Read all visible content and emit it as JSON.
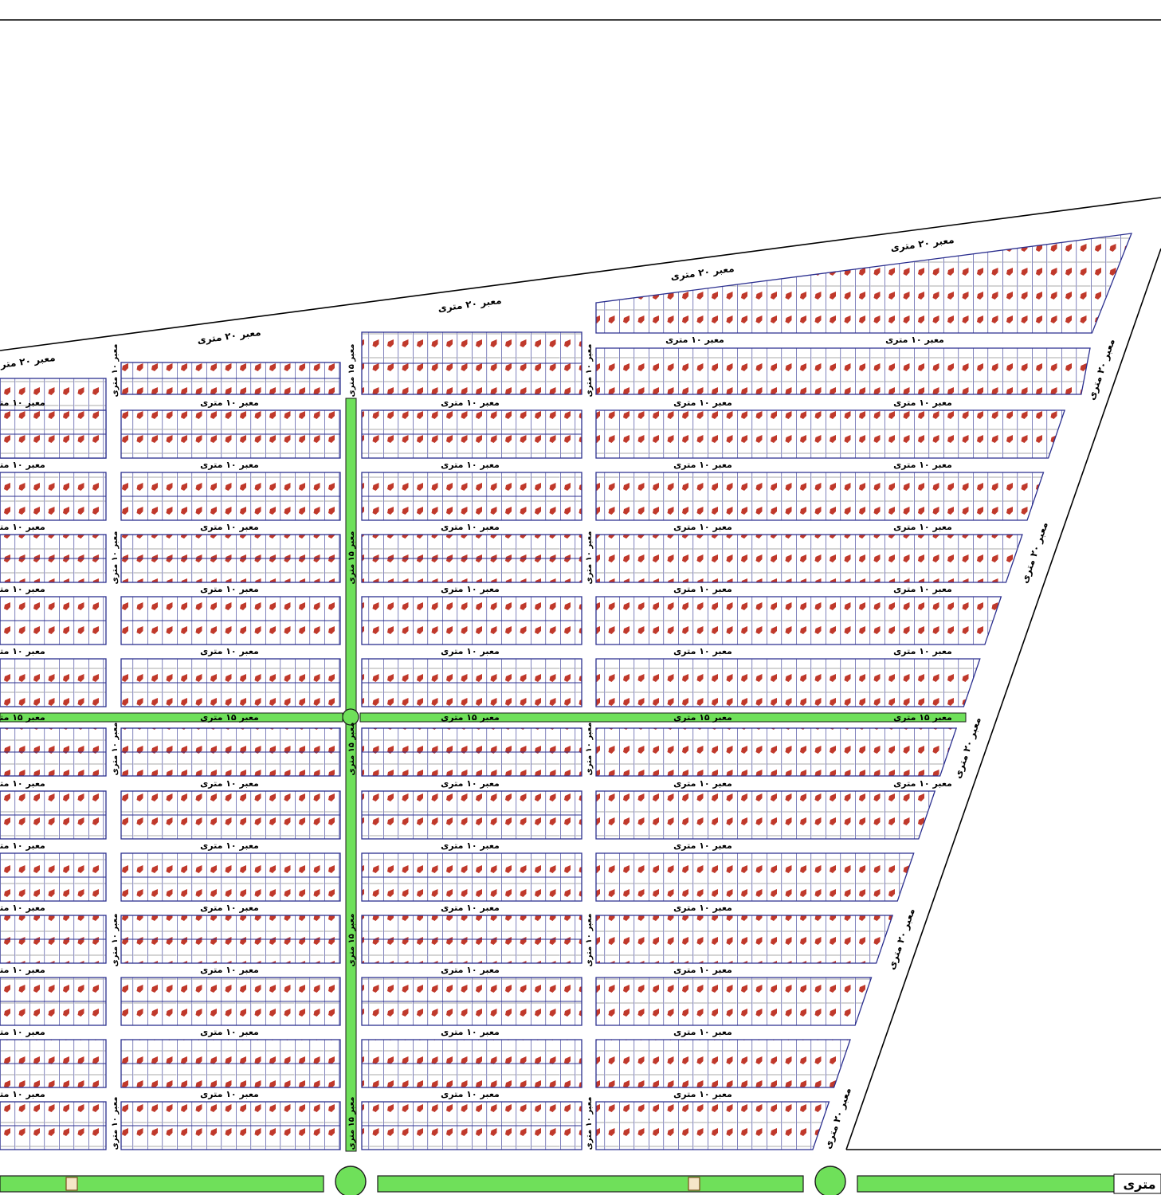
{
  "colors": {
    "background": "#ffffff",
    "outline": "#000000",
    "plot_line": "#2b2f8f",
    "plot_marker": "#c0392b",
    "green_belt": "#6fe05a",
    "green_belt_edge": "#1a1a1a"
  },
  "labels": {
    "road_20": "معبر ۲۰ متری",
    "road_10": "معبر ۱۰ متری",
    "road_15": "معبر ۱۵ متری",
    "road_20_side": "معبر ۲۰ متری",
    "corner_fragment": "متری"
  },
  "legend": {
    "north_road_label_count": 5,
    "icon": "parcel-plot-icon"
  }
}
